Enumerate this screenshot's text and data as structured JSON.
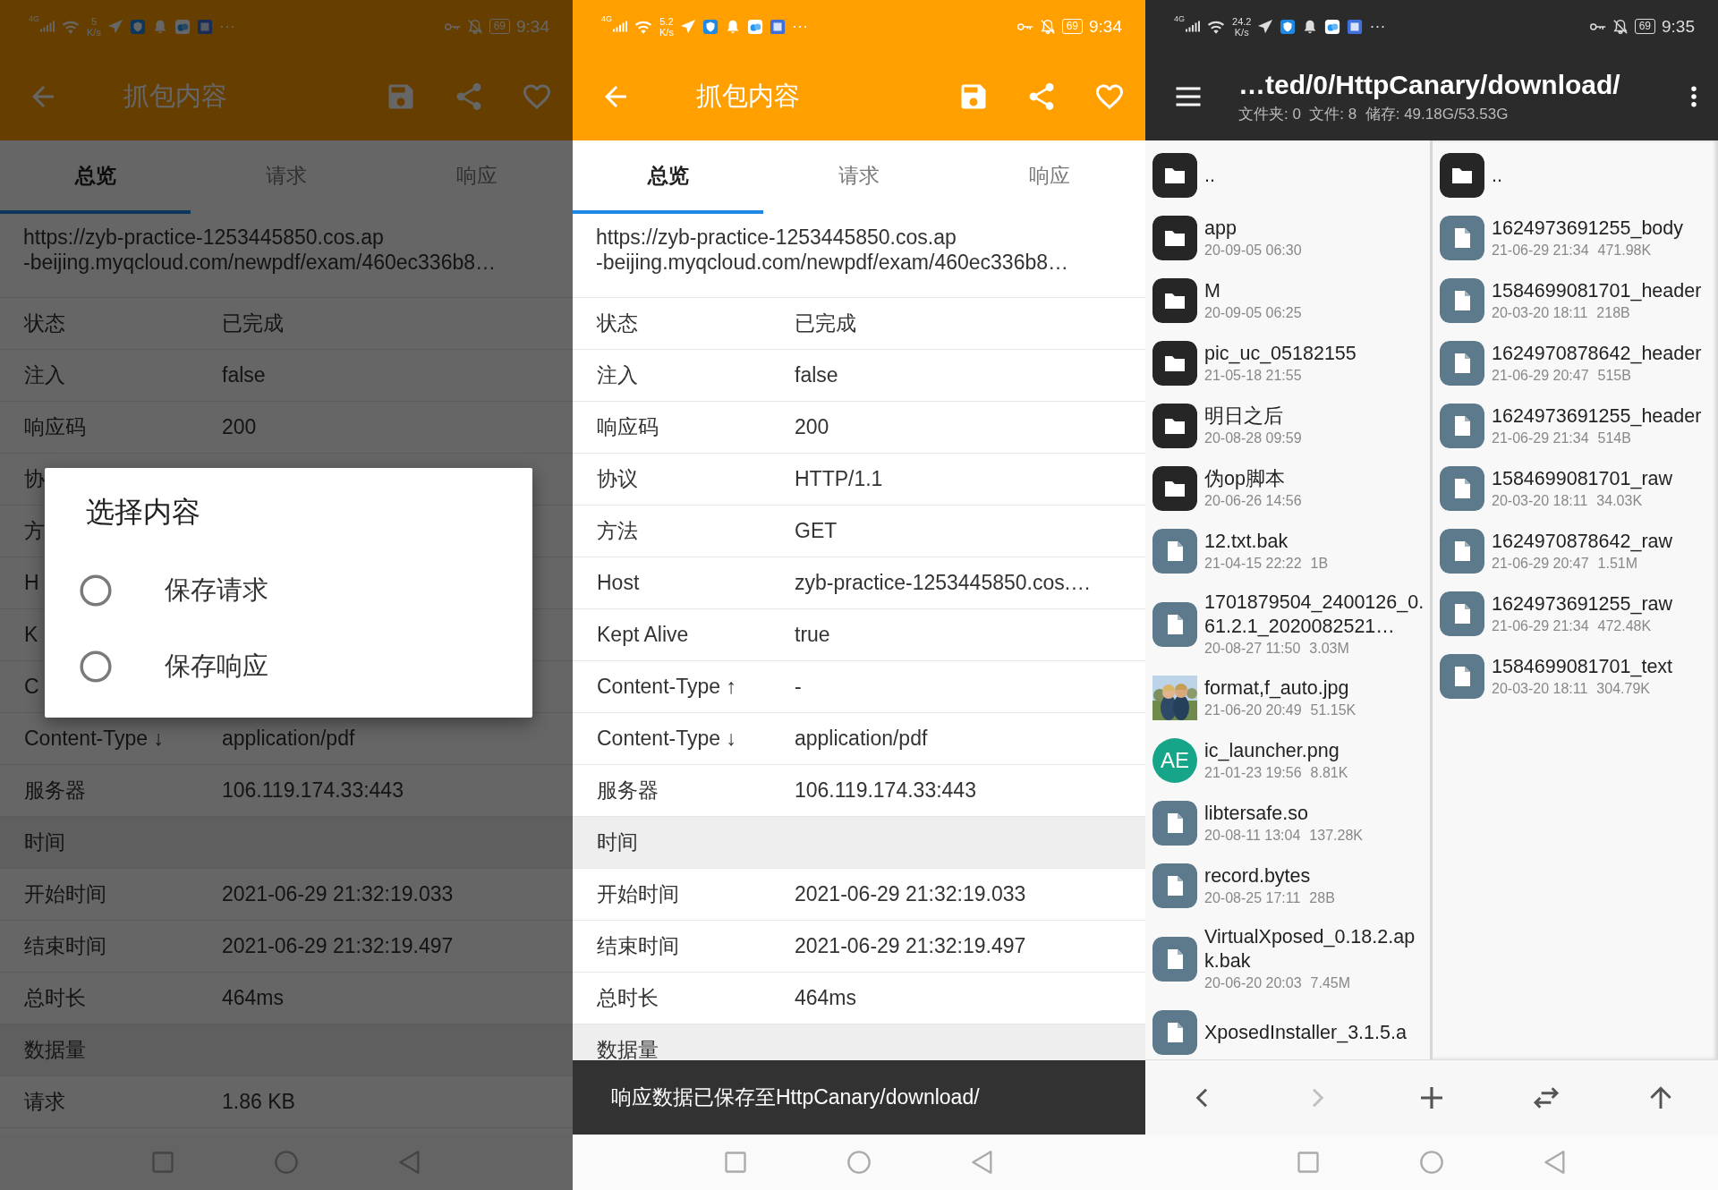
{
  "panels": [
    {
      "kind": "detail",
      "status": {
        "network": "4G",
        "speed": "5",
        "speed_unit": "K/s",
        "more": "···",
        "battery": "69",
        "time": "9:34"
      },
      "title": "抓包内容",
      "tabs": [
        {
          "label": "总览",
          "selected": true
        },
        {
          "label": "请求",
          "selected": false
        },
        {
          "label": "响应",
          "selected": false
        }
      ],
      "url_lines": [
        "https://zyb-practice-1253445850.cos.ap",
        "-beijing.myqcloud.com/newpdf/exam/460ec336b8…"
      ],
      "rows": [
        {
          "kind": "field",
          "label": "状态",
          "value": "已完成"
        },
        {
          "kind": "field",
          "label": "注入",
          "value": "false"
        },
        {
          "kind": "field",
          "label": "响应码",
          "value": "200"
        },
        {
          "kind": "field",
          "label": "协"
        },
        {
          "kind": "field",
          "label": "方"
        },
        {
          "kind": "field",
          "label": "H"
        },
        {
          "kind": "field",
          "label": "K"
        },
        {
          "kind": "field",
          "label": "C"
        },
        {
          "kind": "field",
          "label": "Content-Type ↓",
          "value": "application/pdf"
        },
        {
          "kind": "field",
          "label": "服务器",
          "value": "106.119.174.33:443"
        },
        {
          "kind": "section",
          "label": "时间"
        },
        {
          "kind": "field",
          "label": "开始时间",
          "value": "2021-06-29 21:32:19.033"
        },
        {
          "kind": "field",
          "label": "结束时间",
          "value": "2021-06-29 21:32:19.497"
        },
        {
          "kind": "field",
          "label": "总时长",
          "value": "464ms"
        },
        {
          "kind": "section",
          "label": "数据量"
        },
        {
          "kind": "field",
          "label": "请求",
          "value": "1.86 KB"
        }
      ],
      "dialog": {
        "title": "选择内容",
        "options": [
          {
            "label": "保存请求",
            "selected": false
          },
          {
            "label": "保存响应",
            "selected": false
          }
        ]
      }
    },
    {
      "kind": "detail",
      "status": {
        "network": "4G",
        "speed": "5.2",
        "speed_unit": "K/s",
        "more": "···",
        "battery": "69",
        "time": "9:34"
      },
      "title": "抓包内容",
      "tabs": [
        {
          "label": "总览",
          "selected": true
        },
        {
          "label": "请求",
          "selected": false
        },
        {
          "label": "响应",
          "selected": false
        }
      ],
      "url_lines": [
        "https://zyb-practice-1253445850.cos.ap",
        "-beijing.myqcloud.com/newpdf/exam/460ec336b8…"
      ],
      "rows": [
        {
          "kind": "field",
          "label": "状态",
          "value": "已完成"
        },
        {
          "kind": "field",
          "label": "注入",
          "value": "false"
        },
        {
          "kind": "field",
          "label": "响应码",
          "value": "200"
        },
        {
          "kind": "field",
          "label": "协议",
          "value": "HTTP/1.1"
        },
        {
          "kind": "field",
          "label": "方法",
          "value": "GET"
        },
        {
          "kind": "field",
          "label": "Host",
          "value": "zyb-practice-1253445850.cos.…"
        },
        {
          "kind": "field",
          "label": "Kept Alive",
          "value": "true"
        },
        {
          "kind": "field",
          "label": "Content-Type ↑",
          "value": "-"
        },
        {
          "kind": "field",
          "label": "Content-Type ↓",
          "value": "application/pdf"
        },
        {
          "kind": "field",
          "label": "服务器",
          "value": "106.119.174.33:443"
        },
        {
          "kind": "section",
          "label": "时间"
        },
        {
          "kind": "field",
          "label": "开始时间",
          "value": "2021-06-29 21:32:19.033"
        },
        {
          "kind": "field",
          "label": "结束时间",
          "value": "2021-06-29 21:32:19.497"
        },
        {
          "kind": "field",
          "label": "总时长",
          "value": "464ms"
        },
        {
          "kind": "section",
          "label": "数据量"
        }
      ],
      "snackbar": "响应数据已保存至HttpCanary/download/"
    },
    {
      "kind": "files",
      "status": {
        "network": "4G",
        "speed": "24.2",
        "speed_unit": "K/s",
        "more": "···",
        "battery": "69",
        "time": "9:35"
      },
      "title": "…ted/0/HttpCanary/download/",
      "subtitle": "文件夹: 0  文件: 8  储存: 49.18G/53.53G",
      "columns": [
        {
          "items": [
            {
              "kind": "folder",
              "name": ".."
            },
            {
              "kind": "folder",
              "name": "app",
              "date": "20-09-05 06:30"
            },
            {
              "kind": "folder",
              "name": "M",
              "date": "20-09-05 06:25"
            },
            {
              "kind": "folder",
              "name": "pic_uc_05182155",
              "date": "21-05-18 21:55"
            },
            {
              "kind": "folder",
              "name": "明日之后",
              "date": "20-08-28 09:59"
            },
            {
              "kind": "folder",
              "name": "伪op脚本",
              "date": "20-06-26 14:56"
            },
            {
              "kind": "file",
              "name": "12.txt.bak",
              "date": "21-04-15 22:22",
              "size": "1B"
            },
            {
              "kind": "file",
              "name": "1701879504_2400126_0.61.2.1_2020082521…",
              "date": "20-08-27 11:50",
              "size": "3.03M"
            },
            {
              "kind": "picture",
              "name": "format,f_auto.jpg",
              "date": "21-06-20 20:49",
              "size": "51.15K"
            },
            {
              "kind": "app-icon",
              "icon_text": "AE",
              "name": "ic_launcher.png",
              "date": "21-01-23 19:56",
              "size": "8.81K"
            },
            {
              "kind": "file",
              "name": "libtersafe.so",
              "date": "20-08-11 13:04",
              "size": "137.28K"
            },
            {
              "kind": "file",
              "name": "record.bytes",
              "date": "20-08-25 17:11",
              "size": "28B"
            },
            {
              "kind": "file",
              "name": "VirtualXposed_0.18.2.apk.bak",
              "date": "20-06-20 20:03",
              "size": "7.45M"
            },
            {
              "kind": "file",
              "name": "XposedInstaller_3.1.5.a"
            }
          ]
        },
        {
          "items": [
            {
              "kind": "folder",
              "name": ".."
            },
            {
              "kind": "file",
              "name": "1624973691255_body",
              "date": "21-06-29 21:34",
              "size": "471.98K"
            },
            {
              "kind": "file",
              "name": "1584699081701_header",
              "date": "20-03-20 18:11",
              "size": "218B"
            },
            {
              "kind": "file",
              "name": "1624970878642_header",
              "date": "21-06-29 20:47",
              "size": "515B"
            },
            {
              "kind": "file",
              "name": "1624973691255_header",
              "date": "21-06-29 21:34",
              "size": "514B"
            },
            {
              "kind": "file",
              "name": "1584699081701_raw",
              "date": "20-03-20 18:11",
              "size": "34.03K"
            },
            {
              "kind": "file",
              "name": "1624970878642_raw",
              "date": "21-06-29 20:47",
              "size": "1.51M"
            },
            {
              "kind": "file",
              "name": "1624973691255_raw",
              "date": "21-06-29 21:34",
              "size": "472.48K"
            },
            {
              "kind": "file",
              "name": "1584699081701_text",
              "date": "20-03-20 18:11",
              "size": "304.79K"
            }
          ]
        }
      ],
      "toolbar": [
        {
          "kind": "back",
          "disabled": false
        },
        {
          "kind": "forward",
          "disabled": true
        },
        {
          "kind": "add",
          "disabled": false
        },
        {
          "kind": "swap",
          "disabled": false
        },
        {
          "kind": "up",
          "disabled": false
        }
      ]
    }
  ]
}
